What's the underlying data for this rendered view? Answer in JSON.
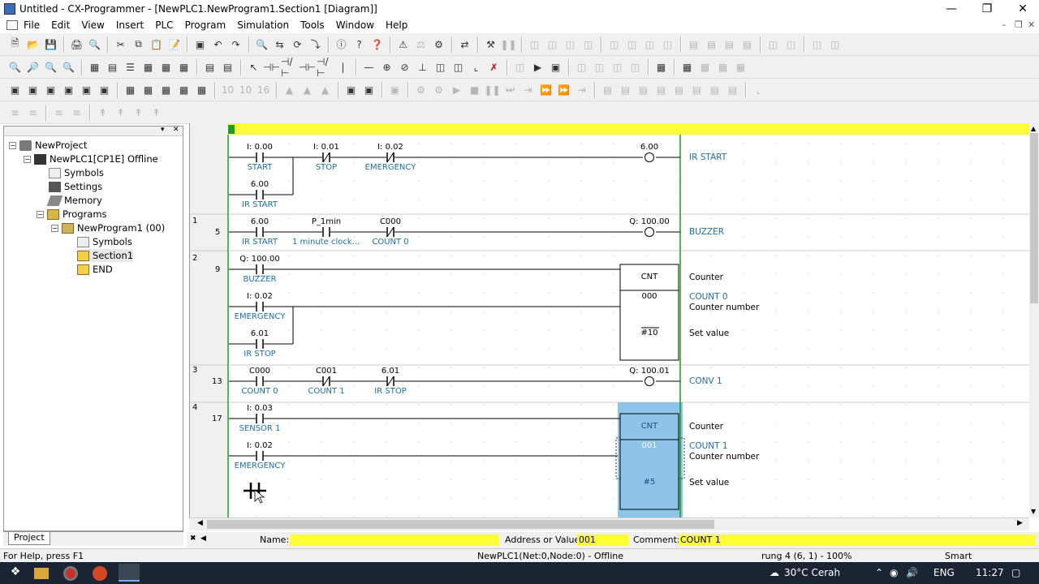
{
  "window": {
    "title": "Untitled - CX-Programmer - [NewPLC1.NewProgram1.Section1 [Diagram]]"
  },
  "menu": [
    "File",
    "Edit",
    "View",
    "Insert",
    "PLC",
    "Program",
    "Simulation",
    "Tools",
    "Window",
    "Help"
  ],
  "tree": {
    "project": "NewProject",
    "plc": "NewPLC1[CP1E] Offline",
    "symbols": "Symbols",
    "settings": "Settings",
    "memory": "Memory",
    "programs": "Programs",
    "program": "NewProgram1 (00)",
    "psymbols": "Symbols",
    "section": "Section1",
    "end": "END",
    "tab": "Project"
  },
  "rungs": [
    {
      "num": "",
      "step": "",
      "contacts": [
        {
          "addr": "I: 0.00",
          "name": "START"
        },
        {
          "addr": "I: 0.01",
          "name": "STOP"
        },
        {
          "addr": "I: 0.02",
          "name": "EMERGENCY"
        },
        {
          "addr": "6.00",
          "name": "IR START"
        }
      ],
      "coil": {
        "addr": "6.00",
        "name": "IR START"
      }
    },
    {
      "num": "1",
      "step": "5",
      "contacts": [
        {
          "addr": "6.00",
          "name": "IR START"
        },
        {
          "addr": "P_1min",
          "name": "1 minute clock..."
        },
        {
          "addr": "C000",
          "name": "COUNT 0"
        }
      ],
      "coil": {
        "addr": "Q: 100.00",
        "name": "BUZZER"
      }
    },
    {
      "num": "2",
      "step": "9",
      "contacts": [
        {
          "addr": "Q: 100.00",
          "name": "BUZZER"
        },
        {
          "addr": "I: 0.02",
          "name": "EMERGENCY"
        },
        {
          "addr": "6.01",
          "name": "IR STOP"
        }
      ],
      "cnt": {
        "label": "CNT",
        "num": "000",
        "sv": "#10",
        "c1": "Counter",
        "c2": "COUNT 0",
        "c3": "Counter number",
        "c4": "Set value"
      }
    },
    {
      "num": "3",
      "step": "13",
      "contacts": [
        {
          "addr": "C000",
          "name": "COUNT 0"
        },
        {
          "addr": "C001",
          "name": "COUNT 1"
        },
        {
          "addr": "6.01",
          "name": "IR STOP"
        }
      ],
      "coil": {
        "addr": "Q: 100.01",
        "name": "CONV 1"
      }
    },
    {
      "num": "4",
      "step": "17",
      "contacts": [
        {
          "addr": "I: 0.03",
          "name": "SENSOR 1"
        },
        {
          "addr": "I: 0.02",
          "name": "EMERGENCY"
        }
      ],
      "cnt": {
        "label": "CNT",
        "num": "001",
        "sv": "#5",
        "c1": "Counter",
        "c2": "COUNT 1",
        "c3": "Counter number",
        "c4": "Set value"
      }
    }
  ],
  "statusbar": {
    "name_label": "Name:",
    "name_value": "",
    "addr_label": "Address or Value:",
    "addr_value": "001",
    "comment_label": "Comment:",
    "comment_value": "COUNT 1",
    "help": "For Help, press F1",
    "plcstate": "NewPLC1(Net:0,Node:0) - Offline",
    "rung": "rung 4 (6, 1)  - 100%",
    "mode": "Smart"
  },
  "taskbar": {
    "weather": "30°C  Cerah",
    "lang": "ENG",
    "time": "11:27"
  },
  "colors": {
    "accent": "#ffff3a",
    "comment": "#1e6ea8",
    "selection": "#8ec4ea"
  }
}
